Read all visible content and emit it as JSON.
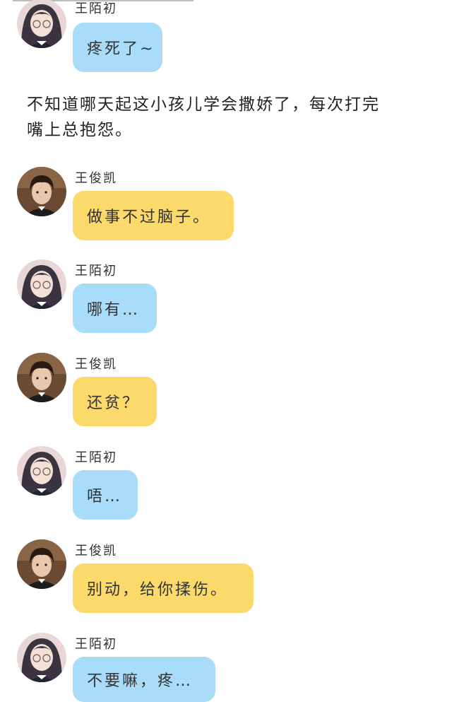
{
  "messages": [
    {
      "sender": "王陌初",
      "text": "疼死了~",
      "color": "blue"
    },
    {
      "sender": "王俊凯",
      "text": "做事不过脑子。",
      "color": "yellow"
    },
    {
      "sender": "王陌初",
      "text": "哪有…",
      "color": "blue"
    },
    {
      "sender": "王俊凯",
      "text": "还贫？",
      "color": "yellow"
    },
    {
      "sender": "王陌初",
      "text": "唔…",
      "color": "blue"
    },
    {
      "sender": "王俊凯",
      "text": "别动，给你揉伤。",
      "color": "yellow"
    },
    {
      "sender": "王陌初",
      "text": "不要嘛，疼…",
      "color": "blue"
    }
  ],
  "narration": {
    "line1": "不知道哪天起这小孩儿学会撒娇了，每次打完",
    "line2": "嘴上总抱怨。"
  },
  "colors": {
    "bubble_blue": "#a9dcf8",
    "bubble_yellow": "#fbd96a",
    "background": "#ffffff"
  },
  "icons": {
    "girl_avatar": "girl-avatar-icon",
    "boy_avatar": "boy-avatar-icon"
  }
}
